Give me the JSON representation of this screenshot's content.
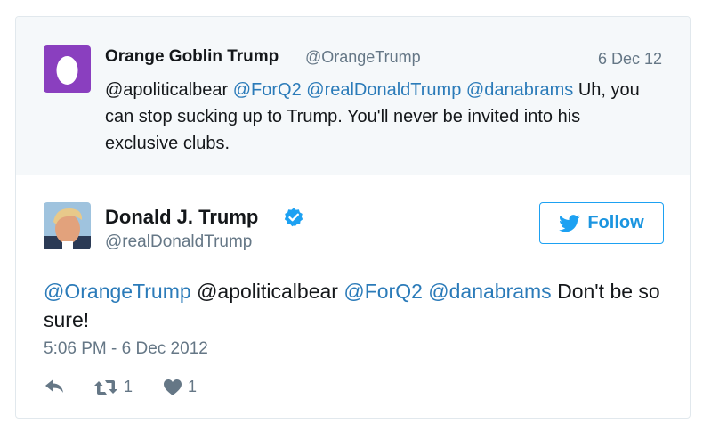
{
  "parent_tweet": {
    "author_name": "Orange Goblin Trump",
    "author_handle": "@OrangeTrump",
    "date": "6 Dec 12",
    "mentions": [
      "@apoliticalbear",
      "@ForQ2",
      "@realDonaldTrump",
      "@danabrams"
    ],
    "text": "Uh, you can stop sucking up to Trump. You'll never be invited into his exclusive clubs."
  },
  "main_tweet": {
    "author_name": "Donald J. Trump",
    "author_handle": "@realDonaldTrump",
    "follow_label": "Follow",
    "mention_1": "@OrangeTrump",
    "plain_1": "@apoliticalbear",
    "mention_2": "@ForQ2",
    "mention_3": "@danabrams",
    "text": "Don't be so sure!",
    "timestamp": "5:06 PM - 6 Dec 2012",
    "retweet_count": "1",
    "like_count": "1"
  },
  "colors": {
    "link": "#2b7bb9",
    "muted": "#657786",
    "egg_purple": "#8a3fbf",
    "twitter_blue": "#1da1f2"
  },
  "icons": [
    "egg-avatar-icon",
    "verified-badge-icon",
    "twitter-bird-icon",
    "reply-icon",
    "retweet-icon",
    "heart-icon"
  ]
}
